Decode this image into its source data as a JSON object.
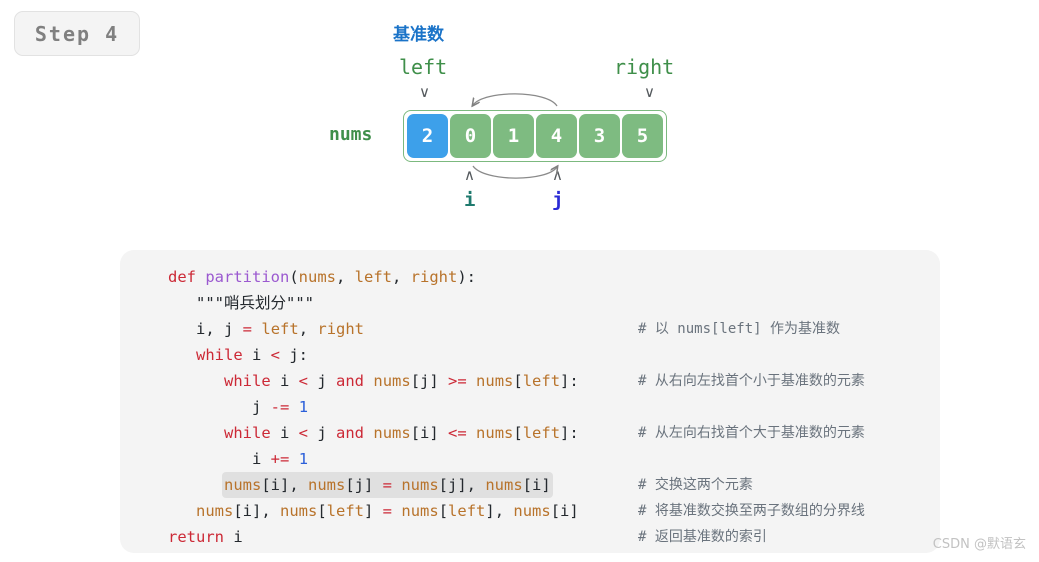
{
  "badge": {
    "label": "Step 4"
  },
  "diagram": {
    "pivot_label": "基准数",
    "left_label": "left",
    "right_label": "right",
    "nums_label": "nums",
    "i_label": "i",
    "j_label": "j",
    "caret_down": "∨",
    "caret_up": "∧",
    "cells": [
      {
        "value": "2",
        "kind": "pivot"
      },
      {
        "value": "0",
        "kind": "normal"
      },
      {
        "value": "1",
        "kind": "normal"
      },
      {
        "value": "4",
        "kind": "normal"
      },
      {
        "value": "3",
        "kind": "normal"
      },
      {
        "value": "5",
        "kind": "normal"
      }
    ],
    "colors": {
      "pivot_cell": "#3da0ea",
      "normal_cell": "#7ebb81",
      "container_border": "#7cb97f",
      "pivot_text": "#1a73c8",
      "green_text": "#3f8f4a",
      "i_text": "#1f7a6e",
      "j_text": "#2b2bd6",
      "arrow": "#808080"
    }
  },
  "code": {
    "language": "python",
    "lines": [
      {
        "indent": 0,
        "highlight": false,
        "tokens": [
          {
            "t": "def ",
            "c": "kw"
          },
          {
            "t": "partition",
            "c": "fn"
          },
          {
            "t": "(",
            "c": "plain"
          },
          {
            "t": "nums",
            "c": "var"
          },
          {
            "t": ", ",
            "c": "plain"
          },
          {
            "t": "left",
            "c": "var"
          },
          {
            "t": ", ",
            "c": "plain"
          },
          {
            "t": "right",
            "c": "var"
          },
          {
            "t": "):",
            "c": "plain"
          }
        ],
        "comment": ""
      },
      {
        "indent": 1,
        "highlight": false,
        "tokens": [
          {
            "t": "\"\"\"哨兵划分\"\"\"",
            "c": "str"
          }
        ],
        "comment": ""
      },
      {
        "indent": 1,
        "highlight": false,
        "tokens": [
          {
            "t": "i, j ",
            "c": "plain"
          },
          {
            "t": "=",
            "c": "op"
          },
          {
            "t": " ",
            "c": "plain"
          },
          {
            "t": "left",
            "c": "var"
          },
          {
            "t": ", ",
            "c": "plain"
          },
          {
            "t": "right",
            "c": "var"
          }
        ],
        "comment": "# 以 nums[left] 作为基准数"
      },
      {
        "indent": 1,
        "highlight": false,
        "tokens": [
          {
            "t": "while ",
            "c": "kw"
          },
          {
            "t": "i ",
            "c": "plain"
          },
          {
            "t": "<",
            "c": "op"
          },
          {
            "t": " j:",
            "c": "plain"
          }
        ],
        "comment": ""
      },
      {
        "indent": 2,
        "highlight": false,
        "tokens": [
          {
            "t": "while ",
            "c": "kw"
          },
          {
            "t": "i ",
            "c": "plain"
          },
          {
            "t": "<",
            "c": "op"
          },
          {
            "t": " j ",
            "c": "plain"
          },
          {
            "t": "and",
            "c": "kw"
          },
          {
            "t": " ",
            "c": "plain"
          },
          {
            "t": "nums",
            "c": "var"
          },
          {
            "t": "[j] ",
            "c": "plain"
          },
          {
            "t": ">=",
            "c": "op"
          },
          {
            "t": " ",
            "c": "plain"
          },
          {
            "t": "nums",
            "c": "var"
          },
          {
            "t": "[",
            "c": "plain"
          },
          {
            "t": "left",
            "c": "var"
          },
          {
            "t": "]:",
            "c": "plain"
          }
        ],
        "comment": "# 从右向左找首个小于基准数的元素"
      },
      {
        "indent": 3,
        "highlight": false,
        "tokens": [
          {
            "t": "j ",
            "c": "plain"
          },
          {
            "t": "-=",
            "c": "op"
          },
          {
            "t": " ",
            "c": "plain"
          },
          {
            "t": "1",
            "c": "num"
          }
        ],
        "comment": ""
      },
      {
        "indent": 2,
        "highlight": false,
        "tokens": [
          {
            "t": "while ",
            "c": "kw"
          },
          {
            "t": "i ",
            "c": "plain"
          },
          {
            "t": "<",
            "c": "op"
          },
          {
            "t": " j ",
            "c": "plain"
          },
          {
            "t": "and",
            "c": "kw"
          },
          {
            "t": " ",
            "c": "plain"
          },
          {
            "t": "nums",
            "c": "var"
          },
          {
            "t": "[i] ",
            "c": "plain"
          },
          {
            "t": "<=",
            "c": "op"
          },
          {
            "t": " ",
            "c": "plain"
          },
          {
            "t": "nums",
            "c": "var"
          },
          {
            "t": "[",
            "c": "plain"
          },
          {
            "t": "left",
            "c": "var"
          },
          {
            "t": "]:",
            "c": "plain"
          }
        ],
        "comment": "# 从左向右找首个大于基准数的元素"
      },
      {
        "indent": 3,
        "highlight": false,
        "tokens": [
          {
            "t": "i ",
            "c": "plain"
          },
          {
            "t": "+=",
            "c": "op"
          },
          {
            "t": " ",
            "c": "plain"
          },
          {
            "t": "1",
            "c": "num"
          }
        ],
        "comment": ""
      },
      {
        "indent": 2,
        "highlight": true,
        "tokens": [
          {
            "t": "nums",
            "c": "var"
          },
          {
            "t": "[i], ",
            "c": "plain"
          },
          {
            "t": "nums",
            "c": "var"
          },
          {
            "t": "[j] ",
            "c": "plain"
          },
          {
            "t": "=",
            "c": "op"
          },
          {
            "t": " ",
            "c": "plain"
          },
          {
            "t": "nums",
            "c": "var"
          },
          {
            "t": "[j], ",
            "c": "plain"
          },
          {
            "t": "nums",
            "c": "var"
          },
          {
            "t": "[i]",
            "c": "plain"
          }
        ],
        "comment": "# 交换这两个元素"
      },
      {
        "indent": 1,
        "highlight": false,
        "tokens": [
          {
            "t": "nums",
            "c": "var"
          },
          {
            "t": "[i], ",
            "c": "plain"
          },
          {
            "t": "nums",
            "c": "var"
          },
          {
            "t": "[",
            "c": "plain"
          },
          {
            "t": "left",
            "c": "var"
          },
          {
            "t": "] ",
            "c": "plain"
          },
          {
            "t": "=",
            "c": "op"
          },
          {
            "t": " ",
            "c": "plain"
          },
          {
            "t": "nums",
            "c": "var"
          },
          {
            "t": "[",
            "c": "plain"
          },
          {
            "t": "left",
            "c": "var"
          },
          {
            "t": "], ",
            "c": "plain"
          },
          {
            "t": "nums",
            "c": "var"
          },
          {
            "t": "[i]",
            "c": "plain"
          }
        ],
        "comment": "# 将基准数交换至两子数组的分界线"
      },
      {
        "indent": 0,
        "highlight": false,
        "tokens": [
          {
            "t": "return ",
            "c": "kw"
          },
          {
            "t": "i",
            "c": "plain"
          }
        ],
        "comment": "# 返回基准数的索引"
      }
    ]
  },
  "watermark": {
    "text": "CSDN @默语玄"
  }
}
